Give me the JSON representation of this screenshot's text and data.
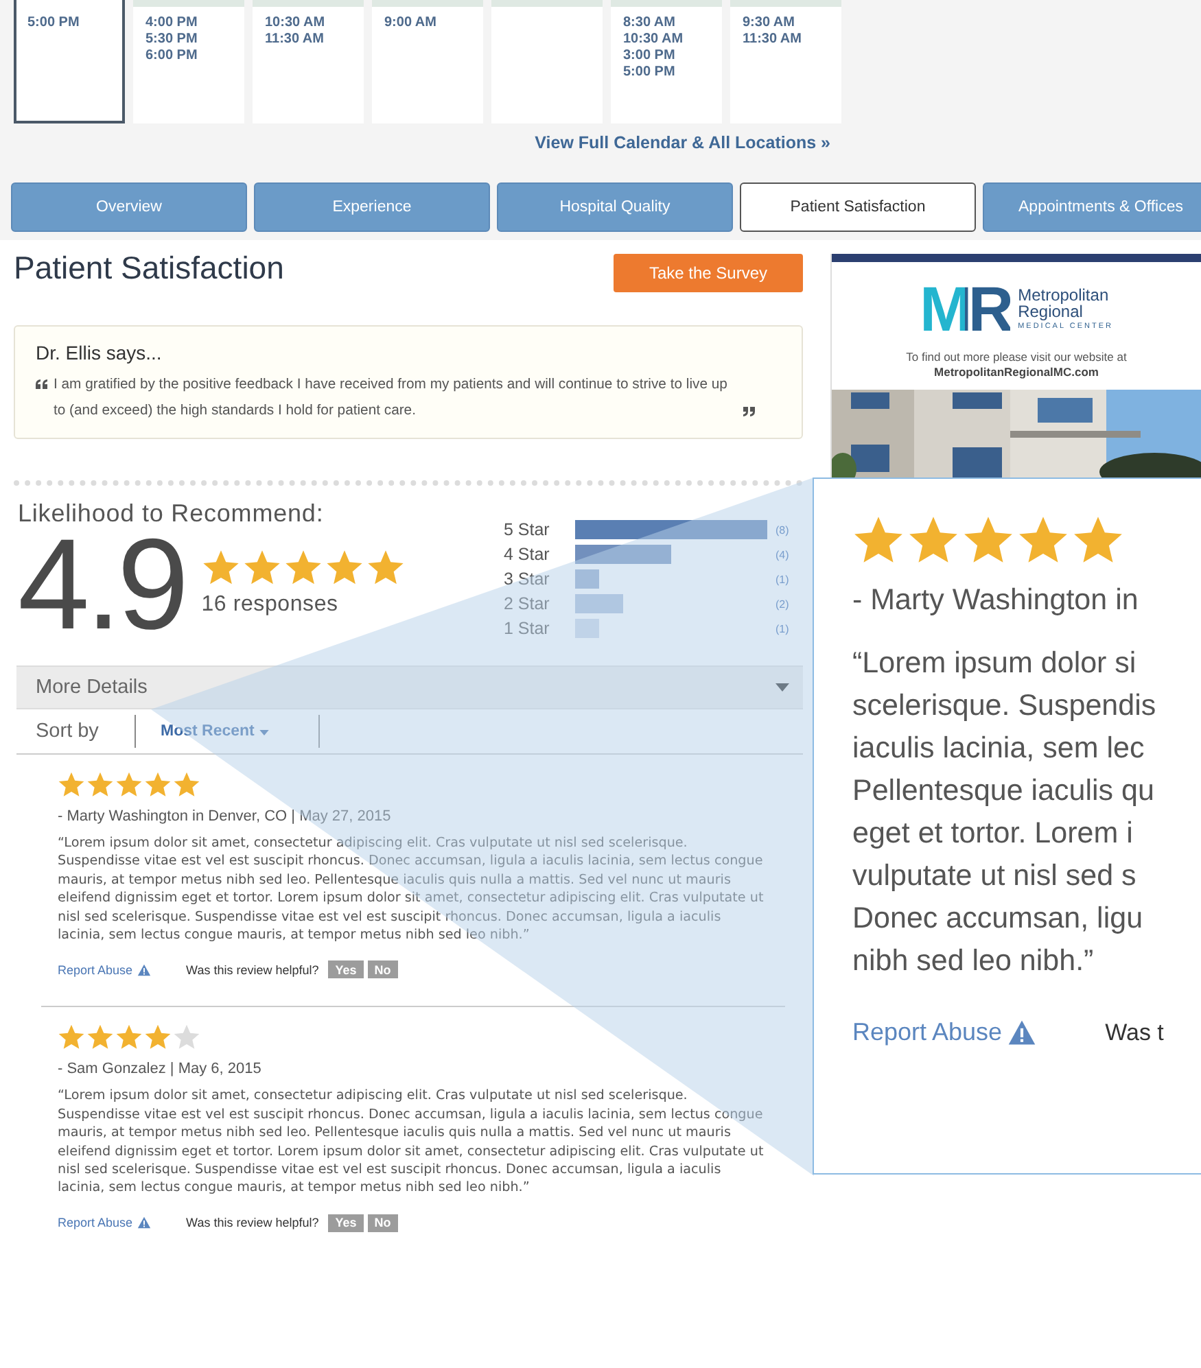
{
  "calendar": {
    "columns": [
      {
        "selected": true,
        "times": [
          "5:00 PM"
        ]
      },
      {
        "selected": false,
        "times": [
          "4:00 PM",
          "5:30 PM",
          "6:00 PM"
        ]
      },
      {
        "selected": false,
        "times": [
          "10:30 AM",
          "11:30 AM"
        ]
      },
      {
        "selected": false,
        "times": [
          "9:00 AM"
        ]
      },
      {
        "selected": false
      },
      {
        "selected": false,
        "times": [
          "8:30 AM",
          "10:30 AM",
          "3:00 PM",
          "5:00 PM"
        ]
      },
      {
        "selected": false,
        "times": [
          "9:30 AM",
          "11:30 AM"
        ]
      }
    ],
    "link": "View Full Calendar & All Locations »"
  },
  "tabs": [
    {
      "label": "Overview",
      "selected": false
    },
    {
      "label": "Experience",
      "selected": false
    },
    {
      "label": "Hospital Quality",
      "selected": false
    },
    {
      "label": "Patient Satisfaction",
      "selected": true
    },
    {
      "label": "Appointments & Offices",
      "selected": false
    }
  ],
  "section": {
    "title": "Patient Satisfaction",
    "survey_button": "Take the Survey"
  },
  "doctor_quote": {
    "title": "Dr. Ellis says...",
    "text": "I am gratified by the positive feedback I have received from my patients and will continue to strive to live up to (and exceed) the high standards I hold for patient care."
  },
  "recommend": {
    "title": "Likelihood to Recommend:",
    "score": "4.9",
    "stars": 5,
    "responses": "16 responses",
    "chart_data": {
      "type": "bar",
      "orientation": "horizontal",
      "categories": [
        "5 Star",
        "4 Star",
        "3 Star",
        "2 Star",
        "1 Star"
      ],
      "values": [
        8,
        4,
        1,
        2,
        1
      ],
      "value_labels": [
        "(8)",
        "(4)",
        "(1)",
        "(2)",
        "(1)"
      ]
    }
  },
  "more_details": {
    "label": "More Details",
    "expanded": false
  },
  "sort": {
    "label": "Sort by",
    "value": "Most Recent"
  },
  "reviews": [
    {
      "stars": 5,
      "author": "- Marty Washington in Denver, CO | May 27, 2015",
      "text": "“Lorem ipsum dolor sit amet, consectetur adipiscing elit. Cras vulputate ut nisl sed scelerisque. Suspendisse vitae est vel est suscipit rhoncus. Donec accumsan, ligula a iaculis lacinia, sem lectus congue mauris, at tempor metus nibh sed leo. Pellentesque iaculis quis nulla a mattis. Sed vel nunc ut mauris eleifend dignissim eget et tortor. Lorem ipsum dolor sit amet, consectetur adipiscing elit. Cras vulputate ut nisl sed scelerisque. Suspendisse vitae est vel est suscipit rhoncus. Donec accumsan, ligula a iaculis lacinia, sem lectus congue mauris, at tempor metus nibh sed leo nibh.”",
      "report": "Report Abuse",
      "helpful": "Was this review helpful?",
      "buttons": [
        "Yes",
        "No"
      ]
    },
    {
      "stars": 4,
      "author": "- Sam Gonzalez | May 6, 2015",
      "text": "“Lorem ipsum dolor sit amet, consectetur adipiscing elit. Cras vulputate ut nisl sed scelerisque. Suspendisse vitae est vel est suscipit rhoncus. Donec accumsan, ligula a iaculis lacinia, sem lectus congue mauris, at tempor metus nibh sed leo. Pellentesque iaculis quis nulla a mattis. Sed vel nunc ut mauris eleifend dignissim eget et tortor. Lorem ipsum dolor sit amet, consectetur adipiscing elit. Cras vulputate ut nisl sed scelerisque. Suspendisse vitae est vel est suscipit rhoncus. Donec accumsan, ligula a iaculis lacinia, sem lectus congue mauris, at tempor metus nibh sed leo nibh.”",
      "report": "Report Abuse",
      "helpful": "Was this review helpful?",
      "buttons": [
        "Yes",
        "No"
      ]
    }
  ],
  "ad": {
    "logo": "MR",
    "name_lines": [
      "Metropolitan",
      "Regional"
    ],
    "subtitle": "MEDICAL CENTER",
    "text": "To find out more please visit our website at",
    "website": "MetropolitanRegionalMC.com"
  },
  "callout": {
    "stars": 5,
    "author": "- Marty Washington in",
    "lines": [
      "“Lorem ipsum dolor si",
      "scelerisque. Suspendis",
      "iaculis lacinia, sem lec",
      "Pellentesque iaculis qu",
      "eget et tortor. Lorem i",
      "vulputate ut nisl sed s",
      "Donec accumsan, ligu",
      "nibh sed leo nibh.”"
    ],
    "report": "Report Abuse",
    "helpful": "Was t"
  }
}
